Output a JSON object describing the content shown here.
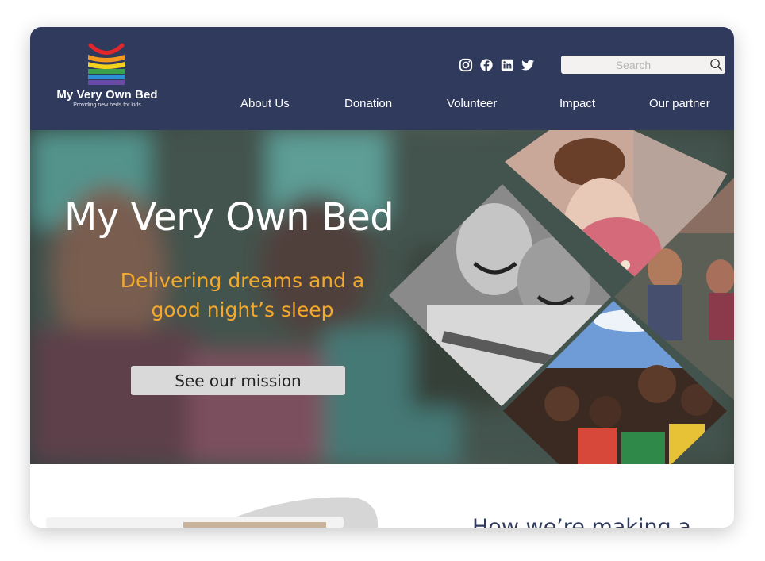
{
  "brand": {
    "name": "My Very Own Bed",
    "tagline": "Providing new beds for kids",
    "logo_colors": [
      "#e4262a",
      "#f29a1f",
      "#f3d21c",
      "#3aa24a",
      "#2c8fd6",
      "#6b4aa5"
    ]
  },
  "header": {
    "background": "#303a5c",
    "socials": [
      {
        "name": "instagram-icon"
      },
      {
        "name": "facebook-icon"
      },
      {
        "name": "linkedin-icon"
      },
      {
        "name": "twitter-icon"
      }
    ],
    "search": {
      "placeholder": "Search",
      "value": ""
    },
    "nav": [
      {
        "label": "About Us"
      },
      {
        "label": "Donation"
      },
      {
        "label": "Volunteer"
      },
      {
        "label": "Impact"
      },
      {
        "label": "Our partner"
      }
    ]
  },
  "hero": {
    "title": "My Very Own Bed",
    "subtitle": "Delivering dreams and a good night’s sleep",
    "cta_label": "See our mission",
    "subtitle_color": "#f2a92c",
    "photos": [
      {
        "name": "photo-girl-playing"
      },
      {
        "name": "photo-boys-laughing"
      },
      {
        "name": "photo-children-hillside"
      },
      {
        "name": "photo-group-of-kids"
      }
    ]
  },
  "lower": {
    "heading": "How we’re making a"
  }
}
